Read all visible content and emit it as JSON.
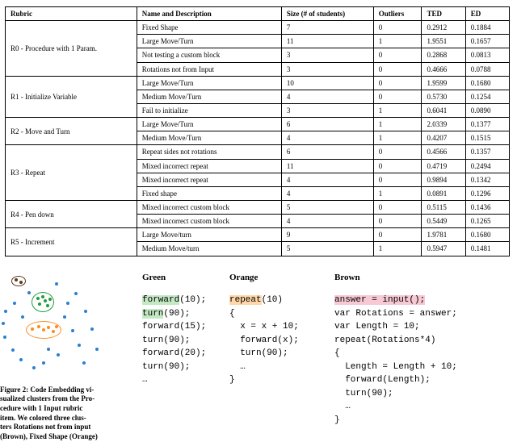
{
  "table": {
    "headers": [
      "Rubric",
      "Name and Description",
      "Size (# of students)",
      "Outliers",
      "TED",
      "ED"
    ],
    "rows": [
      {
        "rubric": "R0 - Procedure with 1 Param.",
        "span": 4,
        "items": [
          {
            "name": "Fixed Shape",
            "size": "7",
            "out": "0",
            "ted": "0.2912",
            "ed": "0.1884"
          },
          {
            "name": "Large Move/Turn",
            "size": "11",
            "out": "1",
            "ted": "1.9551",
            "ed": "0.1657"
          },
          {
            "name": "Not testing a custom block",
            "size": "3",
            "out": "0",
            "ted": "0.2868",
            "ed": "0.0813"
          },
          {
            "name": "Rotations not from Input",
            "size": "3",
            "out": "0",
            "ted": "0.4666",
            "ed": "0.0788"
          }
        ]
      },
      {
        "rubric": "R1 - Initialize Variable",
        "span": 3,
        "items": [
          {
            "name": "Large Move/Turn",
            "size": "10",
            "out": "0",
            "ted": "1.9599",
            "ed": "0.1680"
          },
          {
            "name": "Medium Move/Turn",
            "size": "4",
            "out": "0",
            "ted": "0.5730",
            "ed": "0.1254"
          },
          {
            "name": "Fail to initialize",
            "size": "3",
            "out": "1",
            "ted": "0.6041",
            "ed": "0.0890"
          }
        ]
      },
      {
        "rubric": "R2 - Move and Turn",
        "span": 2,
        "items": [
          {
            "name": "Large Move/Turn",
            "size": "6",
            "out": "1",
            "ted": "2.0339",
            "ed": "0.1377"
          },
          {
            "name": "Medium Move/Turn",
            "size": "4",
            "out": "1",
            "ted": "0.4207",
            "ed": "0.1515"
          }
        ]
      },
      {
        "rubric": "R3 - Repeat",
        "span": 4,
        "items": [
          {
            "name": "Repeat sides not rotations",
            "size": "6",
            "out": "0",
            "ted": "0.4566",
            "ed": "0.1357"
          },
          {
            "name": "Mixed incorrect repeat",
            "size": "11",
            "out": "0",
            "ted": "0.4719",
            "ed": "0.2494"
          },
          {
            "name": "Mixed incorrect repeat",
            "size": "4",
            "out": "0",
            "ted": "0.9894",
            "ed": "0.1342"
          },
          {
            "name": "Fixed shape",
            "size": "4",
            "out": "1",
            "ted": "0.0891",
            "ed": "0.1296"
          }
        ]
      },
      {
        "rubric": "R4 - Pen down",
        "span": 2,
        "items": [
          {
            "name": "Mixed incorrect custom block",
            "size": "5",
            "out": "0",
            "ted": "0.5115",
            "ed": "0.1436"
          },
          {
            "name": "Mixed incorrect custom block",
            "size": "4",
            "out": "0",
            "ted": "0.5449",
            "ed": "0.1265"
          }
        ]
      },
      {
        "rubric": "R5 - Increment",
        "span": 2,
        "items": [
          {
            "name": "Large Move/turn",
            "size": "9",
            "out": "0",
            "ted": "1.9781",
            "ed": "0.1680"
          },
          {
            "name": "Medium Move/turn",
            "size": "5",
            "out": "1",
            "ted": "0.5947",
            "ed": "0.1481"
          }
        ]
      }
    ]
  },
  "figcap": {
    "l1": "Figure 2: Code Embedding vi-",
    "l2": "sualized clusters from the Pro-",
    "l3": "cedure with 1 Input rubric",
    "l4": "item. We colored three clus-",
    "l5": "ters Rotations not from input",
    "l6": "(Brown), Fixed Shape (Orange)"
  },
  "code": {
    "green": {
      "hdr": "Green",
      "l1a": "forward",
      "l1b": "(10);",
      "l2a": "turn",
      "l2b": "(90);",
      "l3": "forward(15);",
      "l4": "turn(90);",
      "l5": "forward(20);",
      "l6": "turn(90);",
      "l7": "…"
    },
    "orange": {
      "hdr": "Orange",
      "l1a": "repeat",
      "l1b": "(10)",
      "l2": "{",
      "l3": "  x = x + 10;",
      "l4": "  forward(x);",
      "l5": "  turn(90);",
      "l6": "  …",
      "l7": "}"
    },
    "brown": {
      "hdr": "Brown",
      "l1a": "answer = input();",
      "l2": "var Rotations = answer;",
      "l3": "var Length = 10;",
      "l4": "repeat(Rotations*4)",
      "l5": "{",
      "l6": "  Length = Length + 10;",
      "l7": "  forward(Length);",
      "l8": "  turn(90);",
      "l9": "  …",
      "l10": "}"
    }
  }
}
